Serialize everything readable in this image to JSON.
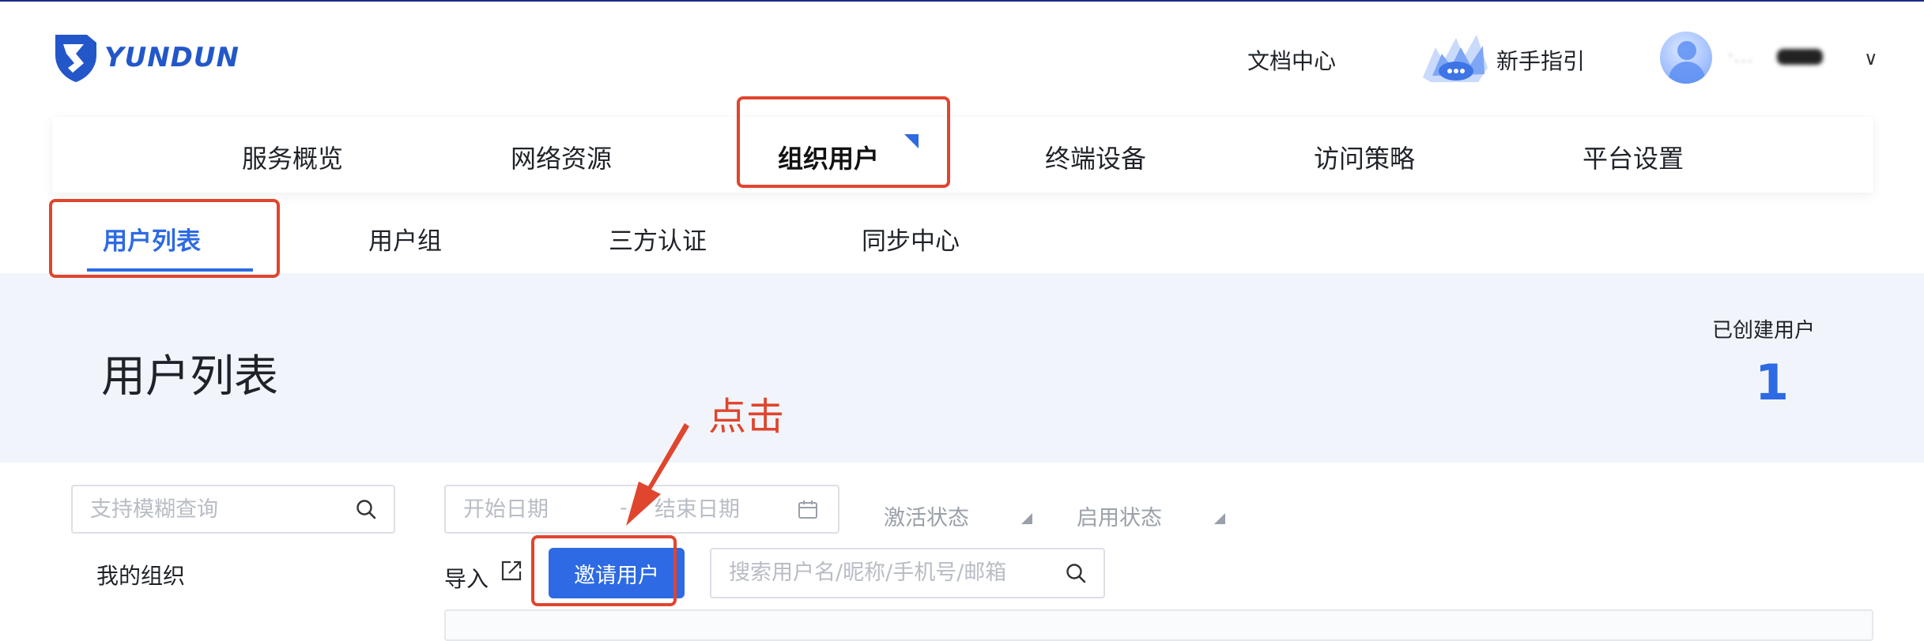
{
  "header": {
    "logo_text": "YUNDUN",
    "doc_center": "文档中心",
    "guide": "新手指引",
    "user_name": "·..."
  },
  "main_nav": {
    "items": [
      {
        "label": "服务概览"
      },
      {
        "label": "网络资源"
      },
      {
        "label": "组织用户",
        "active": true
      },
      {
        "label": "终端设备"
      },
      {
        "label": "访问策略"
      },
      {
        "label": "平台设置"
      }
    ]
  },
  "sub_tabs": {
    "items": [
      {
        "label": "用户列表",
        "active": true
      },
      {
        "label": "用户组"
      },
      {
        "label": "三方认证"
      },
      {
        "label": "同步中心"
      }
    ]
  },
  "banner": {
    "title": "用户列表",
    "stat_label": "已创建用户",
    "stat_value": "1"
  },
  "sidebar": {
    "search_placeholder": "支持模糊查询",
    "my_org": "我的组织"
  },
  "filters": {
    "start_date_placeholder": "开始日期",
    "separator": "-",
    "end_date_placeholder": "结束日期",
    "activation_status": "激活状态",
    "enable_status": "启用状态"
  },
  "toolbar": {
    "import_label": "导入",
    "invite_button": "邀请用户",
    "user_search_placeholder": "搜索用户名/昵称/手机号/邮箱"
  },
  "annotation": {
    "note": "点击"
  },
  "colors": {
    "accent": "#2d6ae3",
    "highlight": "#e0452e",
    "banner_bg": "#f1f5fb"
  }
}
